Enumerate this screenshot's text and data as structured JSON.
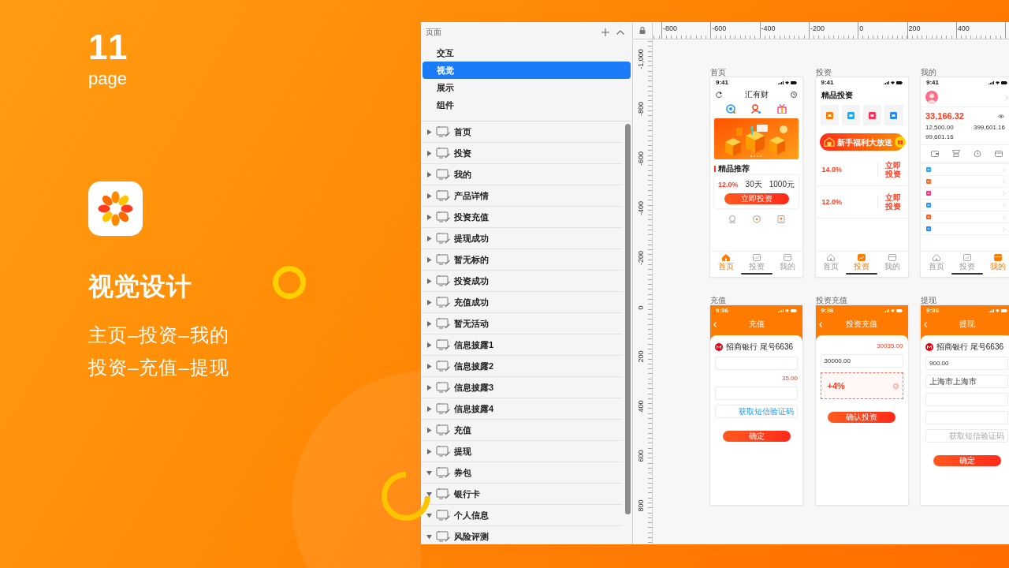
{
  "cover": {
    "number": "11",
    "word": "page",
    "title": "视觉设计",
    "lines": [
      "主页–投资–我的",
      "投资–充值–提现"
    ]
  },
  "pages_panel": {
    "header": "页面",
    "pages": [
      {
        "label": "交互",
        "selected": false
      },
      {
        "label": "视觉",
        "selected": true
      },
      {
        "label": "展示",
        "selected": false
      },
      {
        "label": "组件",
        "selected": false
      }
    ]
  },
  "layers": [
    {
      "label": "首页",
      "expanded": false
    },
    {
      "label": "投资",
      "expanded": false
    },
    {
      "label": "我的",
      "expanded": false
    },
    {
      "label": "产品详情",
      "expanded": false
    },
    {
      "label": "投资充值",
      "expanded": false
    },
    {
      "label": "提现成功",
      "expanded": false
    },
    {
      "label": "暂无标的",
      "expanded": false
    },
    {
      "label": "投资成功",
      "expanded": false
    },
    {
      "label": "充值成功",
      "expanded": false
    },
    {
      "label": "暂无活动",
      "expanded": false
    },
    {
      "label": "信息披露1",
      "expanded": false
    },
    {
      "label": "信息披露2",
      "expanded": false
    },
    {
      "label": "信息披露3",
      "expanded": false
    },
    {
      "label": "信息披露4",
      "expanded": false
    },
    {
      "label": "充值",
      "expanded": false
    },
    {
      "label": "提现",
      "expanded": false
    },
    {
      "label": "券包",
      "expanded": true
    },
    {
      "label": "银行卡",
      "expanded": true
    },
    {
      "label": "个人信息",
      "expanded": true
    },
    {
      "label": "风险评测",
      "expanded": true
    }
  ],
  "rulers": {
    "horizontal": [
      "-800",
      "-600",
      "-400",
      "-200",
      "0",
      "200",
      "400"
    ],
    "vertical": [
      "-1,000",
      "-800",
      "-600",
      "-400",
      "-200",
      "0",
      "200",
      "400",
      "600",
      "800"
    ]
  },
  "artboards": [
    {
      "kind": "home",
      "label": "首页",
      "time": "9:41",
      "title": "汇有财",
      "section": "精品推荐",
      "product": {
        "rate": "12.0%",
        "term": "30天",
        "amount": "1000元"
      },
      "button": "立即投资",
      "tabs": [
        {
          "label": "首页",
          "selected": true
        },
        {
          "label": "投资",
          "selected": false
        },
        {
          "label": "我的",
          "selected": false
        }
      ]
    },
    {
      "kind": "invest",
      "label": "投资",
      "time": "9:41",
      "title": "精品投资",
      "categories": [
        {
          "color": "#ff7a00"
        },
        {
          "color": "#1ea7f2"
        },
        {
          "color": "#ff2d55"
        },
        {
          "color": "#1e88ff"
        }
      ],
      "banner": "新手福利大放送",
      "products": [
        {
          "rate": "14.0%",
          "action": "立即投资"
        },
        {
          "rate": "12.0%",
          "action": "立即投资"
        }
      ],
      "tabs": [
        {
          "label": "首页",
          "selected": false
        },
        {
          "label": "投资",
          "selected": true
        },
        {
          "label": "我的",
          "selected": false
        }
      ]
    },
    {
      "kind": "mine",
      "label": "我的",
      "time": "9:41",
      "total": "33,166.32",
      "figures": [
        "12,500.00",
        "399,601.16"
      ],
      "balance": "99,601.16",
      "menu": [
        {
          "color": "#1eaaf5"
        },
        {
          "color": "#ff6a1a"
        },
        {
          "color": "#ff2d8a"
        },
        {
          "color": "#1e9bff"
        },
        {
          "color": "#ff5a1a"
        },
        {
          "color": "#1e88ff"
        }
      ],
      "tabs": [
        {
          "label": "首页",
          "selected": false
        },
        {
          "label": "投资",
          "selected": false
        },
        {
          "label": "我的",
          "selected": true
        }
      ]
    },
    {
      "kind": "recharge",
      "label": "充值",
      "time": "9:36",
      "title": "充值",
      "bank": "招商银行 尾号6636",
      "available": "35.00",
      "code_link": "获取短信验证码",
      "button": "确定"
    },
    {
      "kind": "invest_recharge",
      "label": "投资充值",
      "time": "9:36",
      "title": "投资充值",
      "available": "30035.00",
      "amount": "30000.00",
      "coupon": "+4%",
      "button": "确认投资"
    },
    {
      "kind": "withdraw",
      "label": "提现",
      "time": "9:36",
      "title": "提现",
      "bank": "招商银行 尾号6636",
      "amount": "900.00",
      "region": "上海市上海市",
      "code_link": "获取短信验证码",
      "button": "确定"
    }
  ]
}
